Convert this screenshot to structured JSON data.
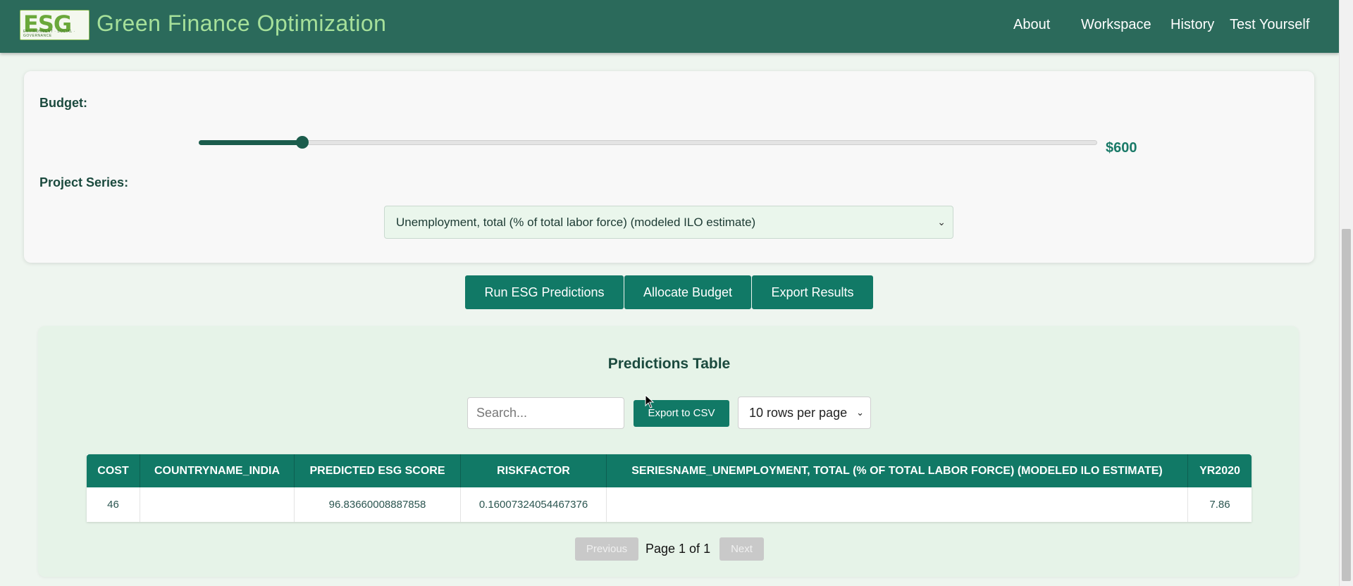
{
  "header": {
    "logo_text": "ESG",
    "logo_subtext": "ENVIRONMENT · SOCIAL · GOVERNANCE",
    "title": "Green Finance Optimization",
    "nav": [
      "About",
      "Workspace",
      "History",
      "Test Yourself"
    ]
  },
  "controls": {
    "budget_label": "Budget:",
    "budget_value": "$600",
    "budget_fraction": 0.115,
    "series_label": "Project Series:",
    "series_selected": "Unemployment, total (% of total labor force) (modeled ILO estimate)"
  },
  "actions": {
    "run": "Run ESG Predictions",
    "allocate": "Allocate Budget",
    "export": "Export Results"
  },
  "table_section": {
    "title": "Predictions Table",
    "search_placeholder": "Search...",
    "export_csv": "Export to CSV",
    "rows_per_page": "10 rows per page",
    "columns": [
      "COST",
      "COUNTRYNAME_INDIA",
      "PREDICTED ESG SCORE",
      "RISKFACTOR",
      "SERIESNAME_UNEMPLOYMENT, TOTAL (% OF TOTAL LABOR FORCE) (MODELED ILO ESTIMATE)",
      "YR2020"
    ],
    "rows": [
      [
        "46",
        "",
        "96.83660008887858",
        "0.16007324054467376",
        "",
        "7.86"
      ]
    ],
    "pagination": {
      "previous": "Previous",
      "page_info": "Page 1 of 1",
      "next": "Next"
    }
  },
  "colors": {
    "header_bg": "#2b6a5b",
    "accent": "#117966",
    "title_green": "#a6e09a"
  }
}
